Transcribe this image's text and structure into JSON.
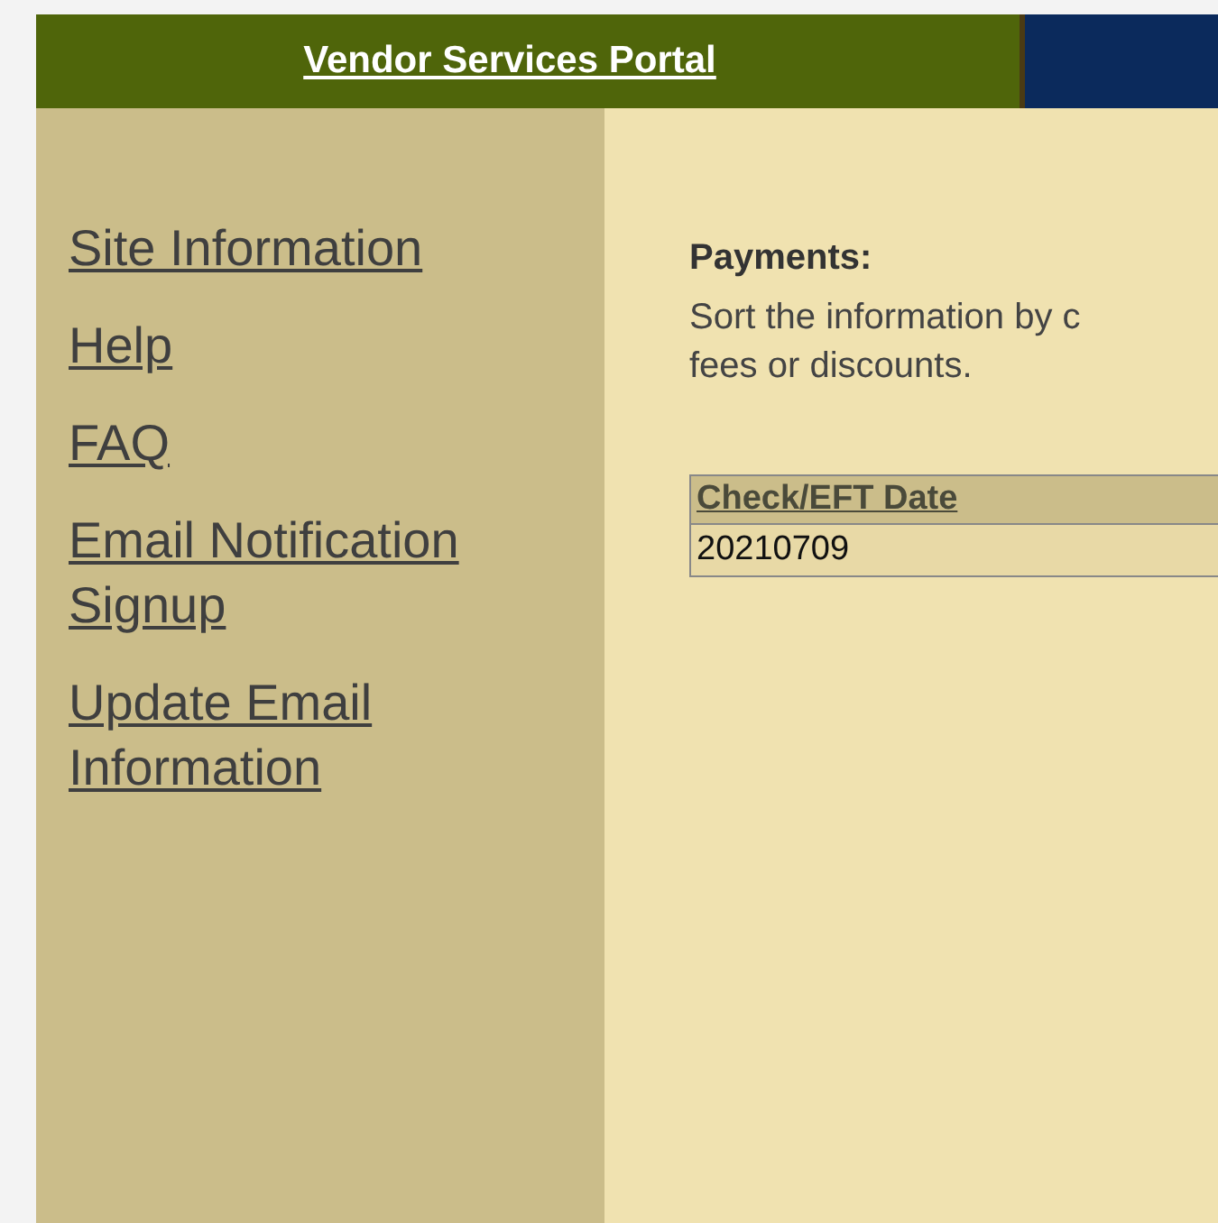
{
  "header": {
    "title": "Vendor Services Portal"
  },
  "sidebar": {
    "links": [
      {
        "label": "Site Information"
      },
      {
        "label": "Help"
      },
      {
        "label": "FAQ"
      },
      {
        "label": "Email Notification Signup"
      },
      {
        "label": "Update Email Information"
      }
    ]
  },
  "main": {
    "heading": "Payments:",
    "description": [
      "Sort the information by c",
      "fees or discounts."
    ],
    "table": {
      "columns": [
        "Check/EFT Date"
      ],
      "rows": [
        [
          "20210709"
        ]
      ]
    }
  }
}
